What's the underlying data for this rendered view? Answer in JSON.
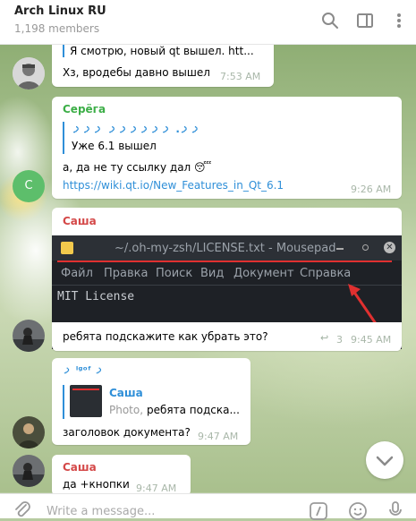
{
  "header": {
    "title": "Arch Linux RU",
    "members": "1,198 members"
  },
  "messages": [
    {
      "reply_text": "Я смотрю, новый qt вышел.  htt...",
      "text": "Хз, вродебы давно вышел",
      "time": "7:53 AM"
    },
    {
      "author": "Серёга",
      "reply_author": "ࡧࡧ. ࡧࡧࡧࡧࡧࡧ ࡧࡧࡧ",
      "reply_text": "Уже 6.1 вышел",
      "text": "а, да не ту ссылку дал 😴",
      "link": "https://wiki.qt.io/New_Features_in_Qt_6.1",
      "time": "9:26 AM",
      "avatar_letter": "С"
    },
    {
      "author": "Саша",
      "screenshot": {
        "window_title": "~/.oh-my-zsh/LICENSE.txt - Mousepad",
        "menu": [
          "Файл",
          "Правка",
          "Поиск",
          "Вид",
          "Документ",
          "Справка"
        ],
        "content": "MIT License"
      },
      "text": "ребята подскажите как убрать это?",
      "replies": "3",
      "time": "9:45 AM"
    },
    {
      "author": "ࡧ ˡᵍᵒᶠ ࡧ",
      "reply_author": "Саша",
      "reply_type": "Photo,",
      "reply_text": " ребята подска...",
      "text": "заголовок документа?",
      "time": "9:47 AM"
    },
    {
      "author": "Саша",
      "text": "да +кнопки",
      "time": "9:47 AM"
    }
  ],
  "composer": {
    "placeholder": "Write a message..."
  },
  "colors": {
    "accent": "#2f8fd8",
    "green_author": "#3cae47",
    "red_author": "#d44848"
  }
}
